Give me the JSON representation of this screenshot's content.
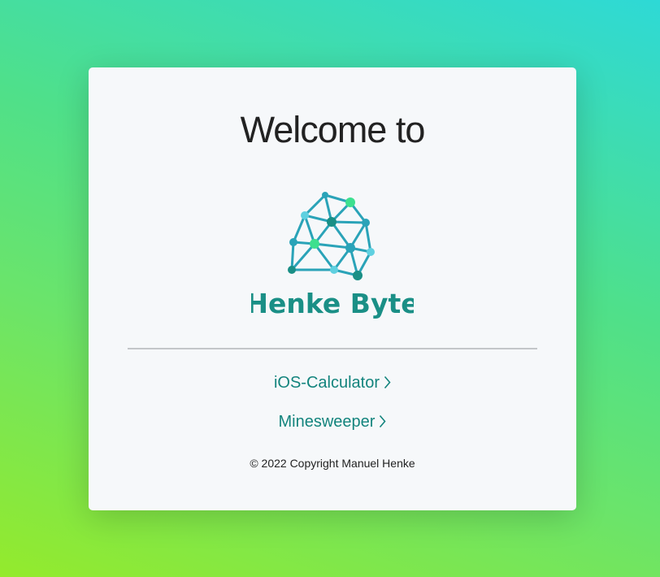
{
  "header": {
    "title": "Welcome to"
  },
  "logo": {
    "brand_name": "Henke Byte",
    "icon": "network-brain-icon",
    "colors": {
      "primary": "#2aa3b8",
      "dark": "#1a8f86",
      "accent": "#3de08f",
      "light": "#5fd0e0"
    }
  },
  "links": [
    {
      "label": "iOS-Calculator",
      "icon": "chevron-right-icon"
    },
    {
      "label": "Minesweeper",
      "icon": "chevron-right-icon"
    }
  ],
  "footer": {
    "copyright": "© 2022 Copyright Manuel Henke"
  },
  "theme": {
    "link_color": "#13847d",
    "card_background": "#f6f8fa",
    "gradient": [
      "#94ea2c",
      "#2ed9d6"
    ]
  }
}
